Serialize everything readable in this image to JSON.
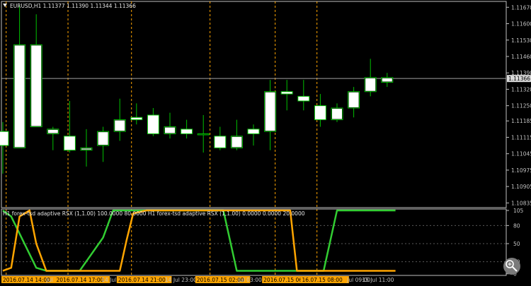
{
  "chart_data": [
    {
      "type": "candlestick",
      "title": "EURUSD,H1  1.11377 1.11390 1.11344 1.11366",
      "ylim": [
        1.10835,
        1.11675
      ],
      "yticks": [
        "1.11670",
        "1.11600",
        "1.11530",
        "1.11460",
        "1.11390",
        "1.11320",
        "1.11250",
        "1.11185",
        "1.11115",
        "1.11045",
        "1.10975",
        "1.10905",
        "1.10835"
      ],
      "current_price": "1.11366",
      "candles": [
        {
          "o": 1.1114,
          "h": 1.1118,
          "l": 1.1096,
          "c": 1.1108
        },
        {
          "o": 1.1107,
          "h": 1.1168,
          "l": 1.1107,
          "c": 1.1151
        },
        {
          "o": 1.1116,
          "h": 1.1164,
          "l": 1.1116,
          "c": 1.1151
        },
        {
          "o": 1.1113,
          "h": 1.1116,
          "l": 1.1106,
          "c": 1.1115
        },
        {
          "o": 1.1112,
          "h": 1.1127,
          "l": 1.1105,
          "c": 1.1106
        },
        {
          "o": 1.1106,
          "h": 1.1115,
          "l": 1.1099,
          "c": 1.1107
        },
        {
          "o": 1.1108,
          "h": 1.1116,
          "l": 1.1101,
          "c": 1.1114
        },
        {
          "o": 1.1114,
          "h": 1.1128,
          "l": 1.111,
          "c": 1.1119
        },
        {
          "o": 1.112,
          "h": 1.1126,
          "l": 1.1117,
          "c": 1.1119
        },
        {
          "o": 1.1121,
          "h": 1.1124,
          "l": 1.1112,
          "c": 1.1113
        },
        {
          "o": 1.1113,
          "h": 1.1122,
          "l": 1.1111,
          "c": 1.1116
        },
        {
          "o": 1.1115,
          "h": 1.1119,
          "l": 1.1111,
          "c": 1.1113
        },
        {
          "o": 1.1113,
          "h": 1.1121,
          "l": 1.1105,
          "c": 1.1113
        },
        {
          "o": 1.1112,
          "h": 1.1116,
          "l": 1.1106,
          "c": 1.1107
        },
        {
          "o": 1.1107,
          "h": 1.1119,
          "l": 1.1106,
          "c": 1.1112
        },
        {
          "o": 1.1115,
          "h": 1.1117,
          "l": 1.1108,
          "c": 1.1113
        },
        {
          "o": 1.1114,
          "h": 1.1136,
          "l": 1.1106,
          "c": 1.1131
        },
        {
          "o": 1.1131,
          "h": 1.1136,
          "l": 1.1123,
          "c": 1.113
        },
        {
          "o": 1.1129,
          "h": 1.1136,
          "l": 1.1123,
          "c": 1.1127
        },
        {
          "o": 1.1125,
          "h": 1.113,
          "l": 1.1116,
          "c": 1.1119
        },
        {
          "o": 1.1119,
          "h": 1.1126,
          "l": 1.1118,
          "c": 1.1124
        },
        {
          "o": 1.1124,
          "h": 1.1133,
          "l": 1.112,
          "c": 1.1131
        },
        {
          "o": 1.1131,
          "h": 1.1145,
          "l": 1.1129,
          "c": 1.1137
        },
        {
          "o": 1.1135,
          "h": 1.1139,
          "l": 1.1133,
          "c": 1.1137
        }
      ]
    },
    {
      "type": "line",
      "title": "H1 forex-tsd adaptive RSX (1,1.00) 100.0000 80.0000  H1 forex-tsd adaptive RSX (1,1.00) 0.0000 0.0000 20.0000",
      "ylim": [
        0,
        105
      ],
      "yticks": [
        "105",
        "80",
        "50",
        "20",
        "0"
      ],
      "levels": [
        80,
        50,
        20
      ],
      "series": [
        {
          "color": "#32cd32",
          "x": [
            0,
            0.5,
            2,
            2.6,
            4,
            4.6,
            6,
            6.6,
            8,
            9.4,
            10,
            11.8,
            12.3,
            12.8,
            13.2,
            13.6,
            14,
            16.8,
            17.2,
            17.6,
            18,
            19.2,
            19.6,
            20,
            23.5
          ],
          "values": [
            105,
            95,
            10,
            5,
            5,
            5,
            60,
            105,
            105,
            105,
            105,
            105,
            105,
            105,
            105,
            55,
            5,
            5,
            5,
            5,
            5,
            5,
            55,
            105,
            105
          ]
        },
        {
          "color": "#ffa500",
          "x": [
            0,
            0.5,
            1,
            1.6,
            2,
            2.6,
            3,
            4.6,
            6,
            7,
            7.4,
            7.8,
            8.6,
            9.4,
            11.8,
            12.2,
            12.6,
            16.6,
            17.2,
            17.6,
            18,
            18.4,
            19,
            23.5
          ],
          "values": [
            5,
            10,
            95,
            105,
            50,
            5,
            5,
            5,
            5,
            5,
            55,
            100,
            105,
            105,
            105,
            105,
            105,
            105,
            105,
            5,
            5,
            5,
            5,
            5
          ]
        }
      ]
    }
  ],
  "xaxis": {
    "labels": [
      {
        "i": 0,
        "text": "2016.07.14 14:00",
        "hl": true
      },
      {
        "i": 2.6,
        "text": "Jul",
        "hl": false
      },
      {
        "i": 3.2,
        "text": "2016.07.14 17:00",
        "hl": true
      },
      {
        "i": 5.9,
        "text": "14 Jul",
        "hl": false
      },
      {
        "i": 6.9,
        "text": "2016.07.14 21:00",
        "hl": true
      },
      {
        "i": 9.7,
        "text": "14 Jul 23:00",
        "hl": false
      },
      {
        "i": 11.6,
        "text": "2016.07.15 02:00",
        "hl": true
      },
      {
        "i": 14.1,
        "text": "Jul 03:00",
        "hl": false
      },
      {
        "i": 15.6,
        "text": "2016.07.15 06:00",
        "hl": true
      },
      {
        "i": 17.9,
        "text": "16.07.15 08:00",
        "hl": true
      },
      {
        "i": 20.6,
        "text": "Jul 09:00",
        "hl": false
      },
      {
        "i": 21.5,
        "text": "15 Jul 11:00",
        "hl": false
      }
    ],
    "vlines": [
      0.2,
      3.9,
      7.7,
      12.4,
      16.3,
      18.8
    ]
  },
  "colors": {
    "bull": "#ffffff",
    "bear": "#ffffff",
    "wick": "#00c000",
    "axis": "#c0c0c0",
    "grid": "#5a5a5a",
    "hl": "#ffa500"
  }
}
